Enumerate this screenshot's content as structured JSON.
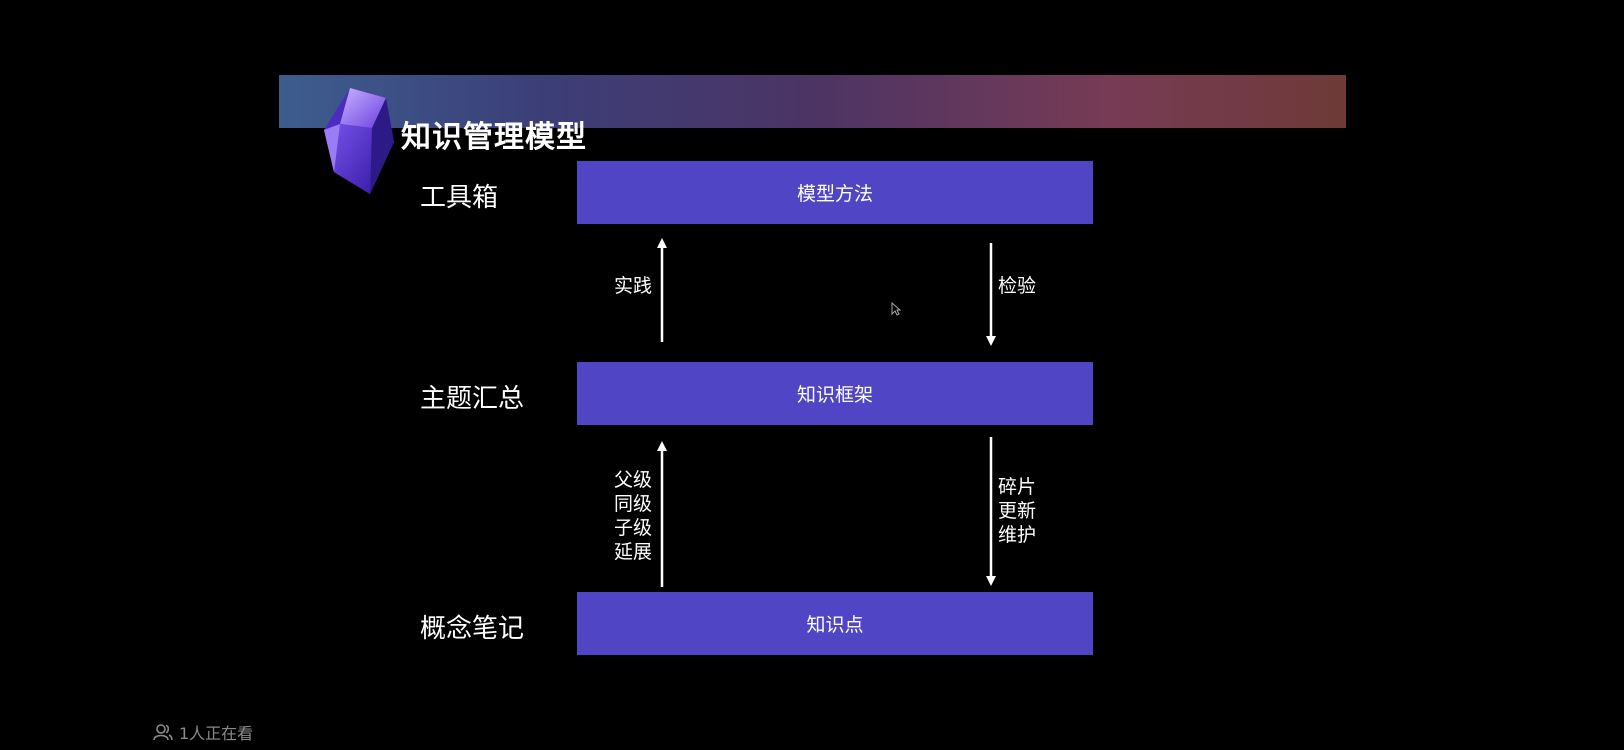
{
  "slide": {
    "title": "知识管理模型"
  },
  "levels": [
    {
      "label": "工具箱",
      "box": "模型方法"
    },
    {
      "label": "主题汇总",
      "box": "知识框架"
    },
    {
      "label": "概念笔记",
      "box": "知识点"
    }
  ],
  "edges": {
    "upper_up": [
      "实践"
    ],
    "upper_down": [
      "检验"
    ],
    "lower_up": [
      "父级",
      "同级",
      "子级",
      "延展"
    ],
    "lower_down": [
      "碎片",
      "更新",
      "维护"
    ]
  },
  "footer": {
    "viewers": "1人正在看",
    "icon": "viewers-icon"
  },
  "colors": {
    "box": "#5045c4",
    "background": "#000000"
  }
}
